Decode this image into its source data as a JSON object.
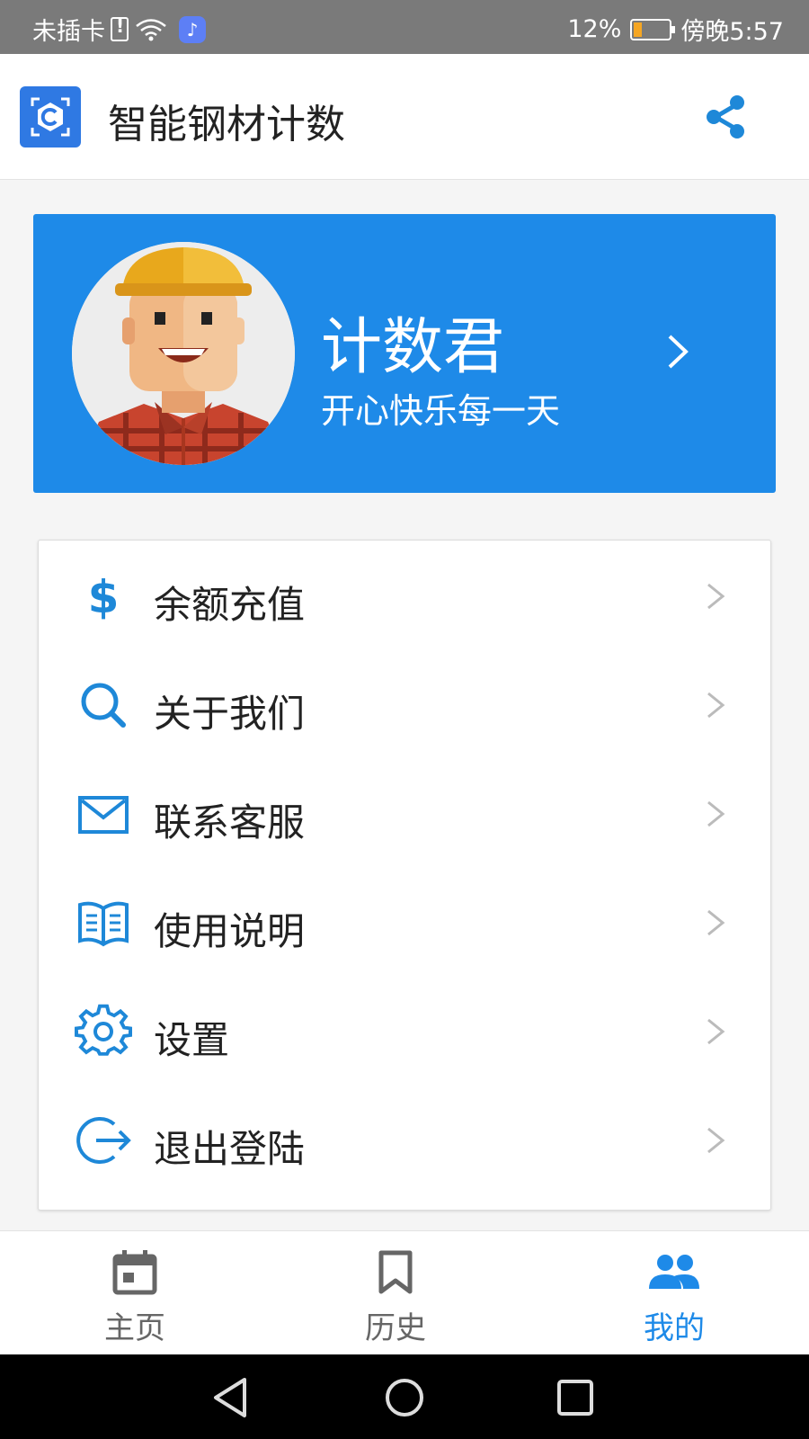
{
  "status_bar": {
    "carrier": "未插卡",
    "battery_percent": "12%",
    "time": "傍晚5:57",
    "battery_level": 0.12
  },
  "app_bar": {
    "title": "智能钢材计数",
    "logo_icon": "app-logo-icon",
    "share_icon": "share-icon"
  },
  "profile": {
    "name": "计数君",
    "motto": "开心快乐每一天",
    "avatar_icon": "worker-avatar"
  },
  "menu": {
    "items": [
      {
        "label": "余额充值",
        "icon": "dollar-icon"
      },
      {
        "label": "关于我们",
        "icon": "search-icon"
      },
      {
        "label": "联系客服",
        "icon": "mail-icon"
      },
      {
        "label": "使用说明",
        "icon": "book-icon"
      },
      {
        "label": "设置",
        "icon": "gear-icon"
      },
      {
        "label": "退出登陆",
        "icon": "logout-icon"
      }
    ]
  },
  "bottom_nav": {
    "items": [
      {
        "label": "主页",
        "icon": "calendar-icon",
        "active": false
      },
      {
        "label": "历史",
        "icon": "bookmark-icon",
        "active": false
      },
      {
        "label": "我的",
        "icon": "people-icon",
        "active": true
      }
    ]
  },
  "colors": {
    "accent": "#1e8ae8",
    "status_bar": "#7a7a7a",
    "icon_blue": "#1e88d8",
    "inactive_gray": "#666666"
  }
}
